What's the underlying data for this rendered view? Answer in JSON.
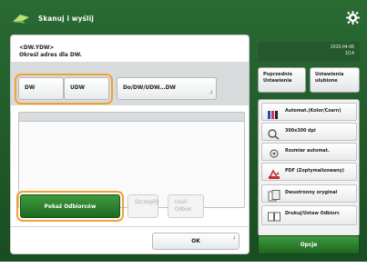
{
  "header": {
    "title": "Skanuj i wyślij",
    "settings_icon": "gear-icon",
    "app_icon": "scan-send-icon"
  },
  "dialog": {
    "title": "<DW.YDW>",
    "subtitle": "Określ adres dla DW.",
    "buttons": {
      "dw": "DW",
      "udw": "UDW",
      "do_dw_udw": "Do/DW/UDW...DW",
      "address_book": "Pokaż Odbiorców",
      "details": "Szczegóły",
      "remove": "Usuń Odbior.",
      "ok": "OK"
    }
  },
  "right_panel": {
    "info": {
      "line1": "2020-04-06",
      "line2": "3/14"
    },
    "tabs": {
      "recent": "Poprzednie Ustawienia",
      "favorites": "Ustawienia ulubione"
    },
    "items": [
      {
        "label": "Automat.(Kolor/Czarn)",
        "icon": "color-mode-icon"
      },
      {
        "label": "300x300 dpi",
        "icon": "resolution-icon"
      },
      {
        "label": "Rozmiar automat.",
        "icon": "scan-size-icon"
      },
      {
        "label": "PDF (Zoptymalizowany)",
        "icon": "pdf-icon"
      },
      {
        "label": "Dwustronny oryginał",
        "icon": "duplex-icon"
      },
      {
        "label": "Drukuj/Ustaw Odbiorc",
        "icon": "double-page-icon"
      }
    ],
    "options": "Opcje"
  },
  "colors": {
    "accent_green": "#2a6a33",
    "highlight_orange": "#f2a132"
  }
}
